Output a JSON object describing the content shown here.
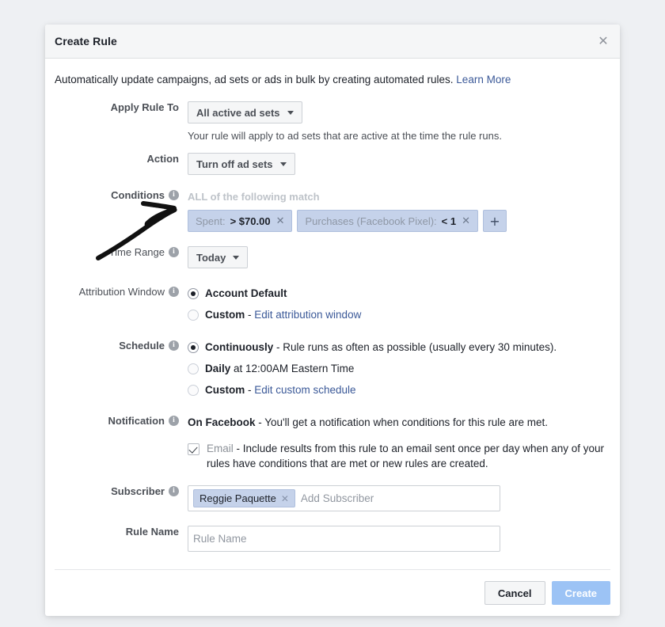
{
  "dialog": {
    "title": "Create Rule",
    "close_icon": "close-icon",
    "intro_text": "Automatically update campaigns, ad sets or ads in bulk by creating automated rules.",
    "intro_link": "Learn More"
  },
  "apply_rule_to": {
    "label": "Apply Rule To",
    "value": "All active ad sets",
    "helper": "Your rule will apply to ad sets that are active at the time the rule runs."
  },
  "action": {
    "label": "Action",
    "value": "Turn off ad sets"
  },
  "conditions": {
    "label": "Conditions",
    "info_icon": "info-icon",
    "match_text": "ALL of the following match",
    "chips": [
      {
        "name": "Spent:",
        "value": "> $70.00",
        "remove_icon": "close-icon"
      },
      {
        "name": "Purchases (Facebook Pixel):",
        "value": "< 1",
        "remove_icon": "close-icon"
      }
    ],
    "add_label": "+"
  },
  "time_range": {
    "label": "Time Range",
    "info_icon": "info-icon",
    "value": "Today"
  },
  "attribution_window": {
    "label": "Attribution Window",
    "info_icon": "info-icon",
    "options": [
      {
        "strong": "Account Default",
        "rest": "",
        "selected": true
      },
      {
        "strong": "Custom",
        "rest": " - ",
        "link": "Edit attribution window",
        "selected": false
      }
    ]
  },
  "schedule": {
    "label": "Schedule",
    "info_icon": "info-icon",
    "options": [
      {
        "strong": "Continuously",
        "rest": " - Rule runs as often as possible (usually every 30 minutes).",
        "selected": true
      },
      {
        "strong": "Daily",
        "rest": " at 12:00AM Eastern Time",
        "selected": false
      },
      {
        "strong": "Custom",
        "rest": " - ",
        "link": "Edit custom schedule",
        "selected": false
      }
    ]
  },
  "notification": {
    "label": "Notification",
    "info_icon": "info-icon",
    "on_facebook_strong": "On Facebook",
    "on_facebook_rest": " - You'll get a notification when conditions for this rule are met.",
    "email_checked": true,
    "email_word": "Email",
    "email_rest": " - Include results from this rule to an email sent once per day when any of your rules have conditions that are met or new rules are created."
  },
  "subscriber": {
    "label": "Subscriber",
    "info_icon": "info-icon",
    "chip": "Reggie Paquette",
    "chip_remove_icon": "close-icon",
    "placeholder": "Add Subscriber"
  },
  "rule_name": {
    "label": "Rule Name",
    "placeholder": "Rule Name",
    "value": ""
  },
  "footer": {
    "cancel": "Cancel",
    "create": "Create"
  },
  "annotation": {
    "arrow": "hand-drawn-arrow"
  },
  "colors": {
    "accent_link": "#3b5998",
    "chip_bg": "#c5d2ea",
    "create_btn": "#9cc3f5",
    "page_bg": "#eef0f3"
  }
}
